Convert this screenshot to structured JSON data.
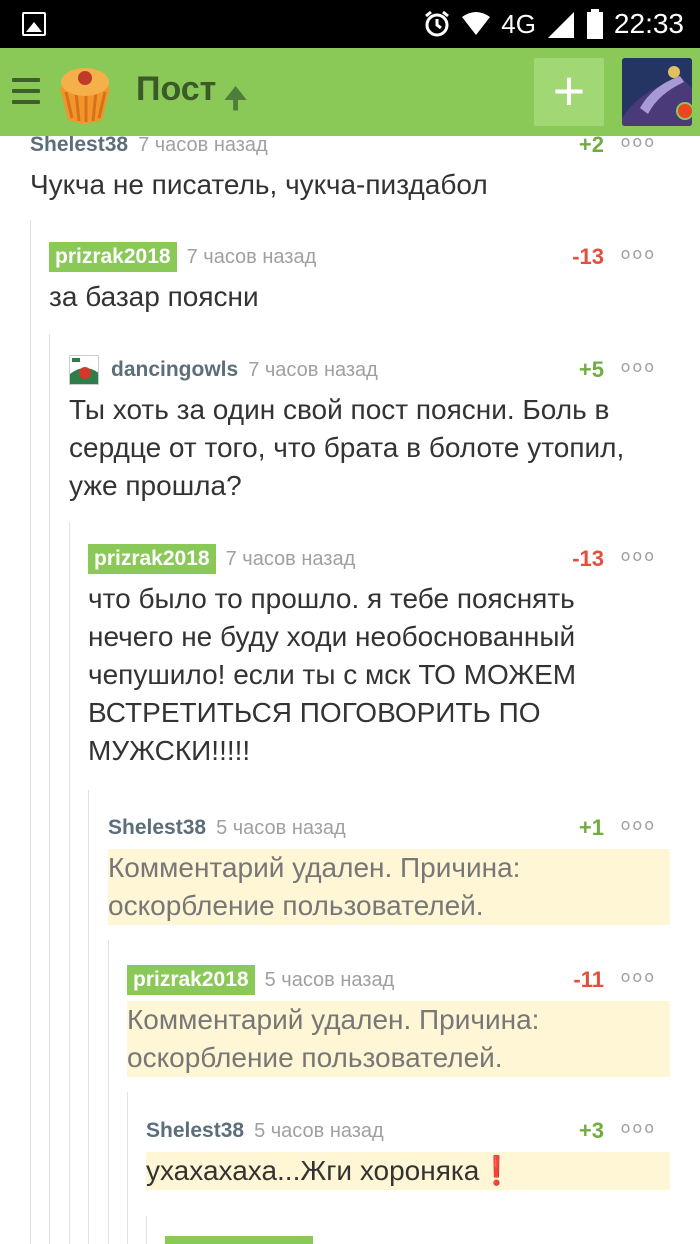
{
  "status_bar": {
    "network": "4G",
    "time": "22:33",
    "icons": [
      "gallery-icon",
      "alarm-icon",
      "wifi-icon",
      "signal-icon",
      "battery-icon"
    ]
  },
  "app_bar": {
    "title": "Пост",
    "add_label": "+",
    "colors": {
      "bar": "#8ac858",
      "title": "#3a5a28"
    }
  },
  "comments": [
    {
      "author": "Shelest38",
      "time": "7 часов назад",
      "rating": "+2",
      "text": "Чукча не писатель, чукча-пиздабол",
      "deleted": false,
      "tagged": false
    },
    {
      "author": "prizrak2018",
      "time": "7 часов назад",
      "rating": "-13",
      "text": "за базар поясни",
      "deleted": false,
      "tagged": true
    },
    {
      "author": "dancingowls",
      "time": "7 часов назад",
      "rating": "+5",
      "text": "Ты хоть за один свой пост поясни. Боль в сердце от того, что брата в болоте утопил, уже прошла?",
      "deleted": false,
      "tagged": false,
      "avatar": true
    },
    {
      "author": "prizrak2018",
      "time": "7 часов назад",
      "rating": "-13",
      "text": "что было то прошло. я тебе пояснять нечего не буду ходи необоснованный чепушило! если ты с мск ТО МОЖЕМ ВСТРЕТИТЬСЯ ПОГОВОРИТЬ ПО МУЖСКИ!!!!!",
      "deleted": false,
      "tagged": true
    },
    {
      "author": "Shelest38",
      "time": "5 часов назад",
      "rating": "+1",
      "text": "Комментарий удален. Причина: оскорбление пользователей.",
      "deleted": true,
      "tagged": false
    },
    {
      "author": "prizrak2018",
      "time": "5 часов назад",
      "rating": "-11",
      "text": "Комментарий удален. Причина: оскорбление пользователей.",
      "deleted": true,
      "tagged": true
    },
    {
      "author": "Shelest38",
      "time": "5 часов назад",
      "rating": "+3",
      "text": "ухахахаха...Жги хороняка❗",
      "deleted": false,
      "tagged": false
    }
  ]
}
